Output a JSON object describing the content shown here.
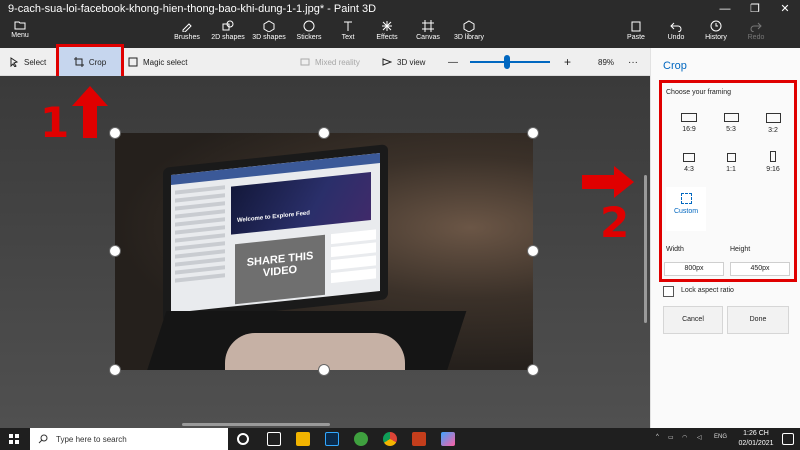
{
  "window": {
    "title": "9-cach-sua-loi-facebook-khong-hien-thong-bao-khi-dung-1-1.jpg* - Paint 3D",
    "minimize": "—",
    "maximize": "❐",
    "close": "✕"
  },
  "ribbon": {
    "menu": "Menu",
    "brushes": "Brushes",
    "shapes2d": "2D shapes",
    "shapes3d": "3D shapes",
    "stickers": "Stickers",
    "text": "Text",
    "effects": "Effects",
    "canvas": "Canvas",
    "library3d": "3D library",
    "paste": "Paste",
    "undo": "Undo",
    "history": "History",
    "redo": "Redo"
  },
  "toolbar": {
    "select": "Select",
    "crop": "Crop",
    "magic_select": "Magic select",
    "mixed_reality": "Mixed reality",
    "view3d": "3D view",
    "zoom_minus": "—",
    "zoom_plus": "+",
    "zoom": "89%",
    "more": "···"
  },
  "image": {
    "banner_text": "Welcome to Explore Feed",
    "video_text": "SHARE THIS VIDEO"
  },
  "annotations": {
    "step1": "1",
    "step2": "2"
  },
  "panel": {
    "title": "Crop",
    "choose_framing": "Choose your framing",
    "frames": [
      {
        "label": "16:9"
      },
      {
        "label": "5:3"
      },
      {
        "label": "3:2"
      },
      {
        "label": "4:3"
      },
      {
        "label": "1:1"
      },
      {
        "label": "9:16"
      },
      {
        "label": "Custom"
      }
    ],
    "width_label": "Width",
    "height_label": "Height",
    "width_value": "800px",
    "height_value": "450px",
    "lock_aspect": "Lock aspect ratio",
    "cancel": "Cancel",
    "done": "Done"
  },
  "taskbar": {
    "search_placeholder": "Type here to search",
    "language": "ENG",
    "time": "1:26 CH",
    "date": "02/01/2021"
  },
  "colors": {
    "accent": "#0067c0",
    "annotation_red": "#e00000",
    "chrome_dark": "#2b2b2b"
  }
}
